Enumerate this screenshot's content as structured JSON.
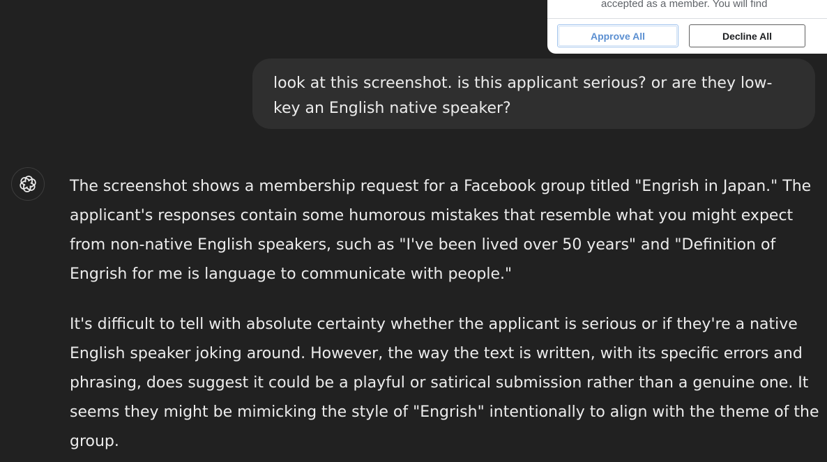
{
  "attached_screenshot": {
    "snippet_text": "have to agree to the rules to be\naccepted as a member. You will find",
    "approve_label": "Approve All",
    "decline_label": "Decline All"
  },
  "user_message": {
    "text": "look at this screenshot. is this applicant serious? or are they low-key an English native speaker?"
  },
  "assistant_message": {
    "avatar_icon": "openai-logo-icon",
    "paragraphs": [
      "The screenshot shows a membership request for a Facebook group titled \"Engrish in Japan.\" The applicant's responses contain some humorous mistakes that resemble what you might expect from non-native English speakers, such as \"I've been lived over 50 years\" and \"Definition of Engrish for me is language to communicate with people.\"",
      "It's difficult to tell with absolute certainty whether the applicant is serious or if they're a native English speaker joking around. However, the way the text is written, with its specific errors and phrasing, does suggest it could be a playful or satirical submission rather than a genuine one. It seems they might be mimicking the style of \"Engrish\" intentionally to align with the theme of the group."
    ]
  },
  "colors": {
    "background": "#212121",
    "user_bubble": "#2f2f2f",
    "text": "#ececec",
    "approve_blue": "#5b8fd1"
  }
}
